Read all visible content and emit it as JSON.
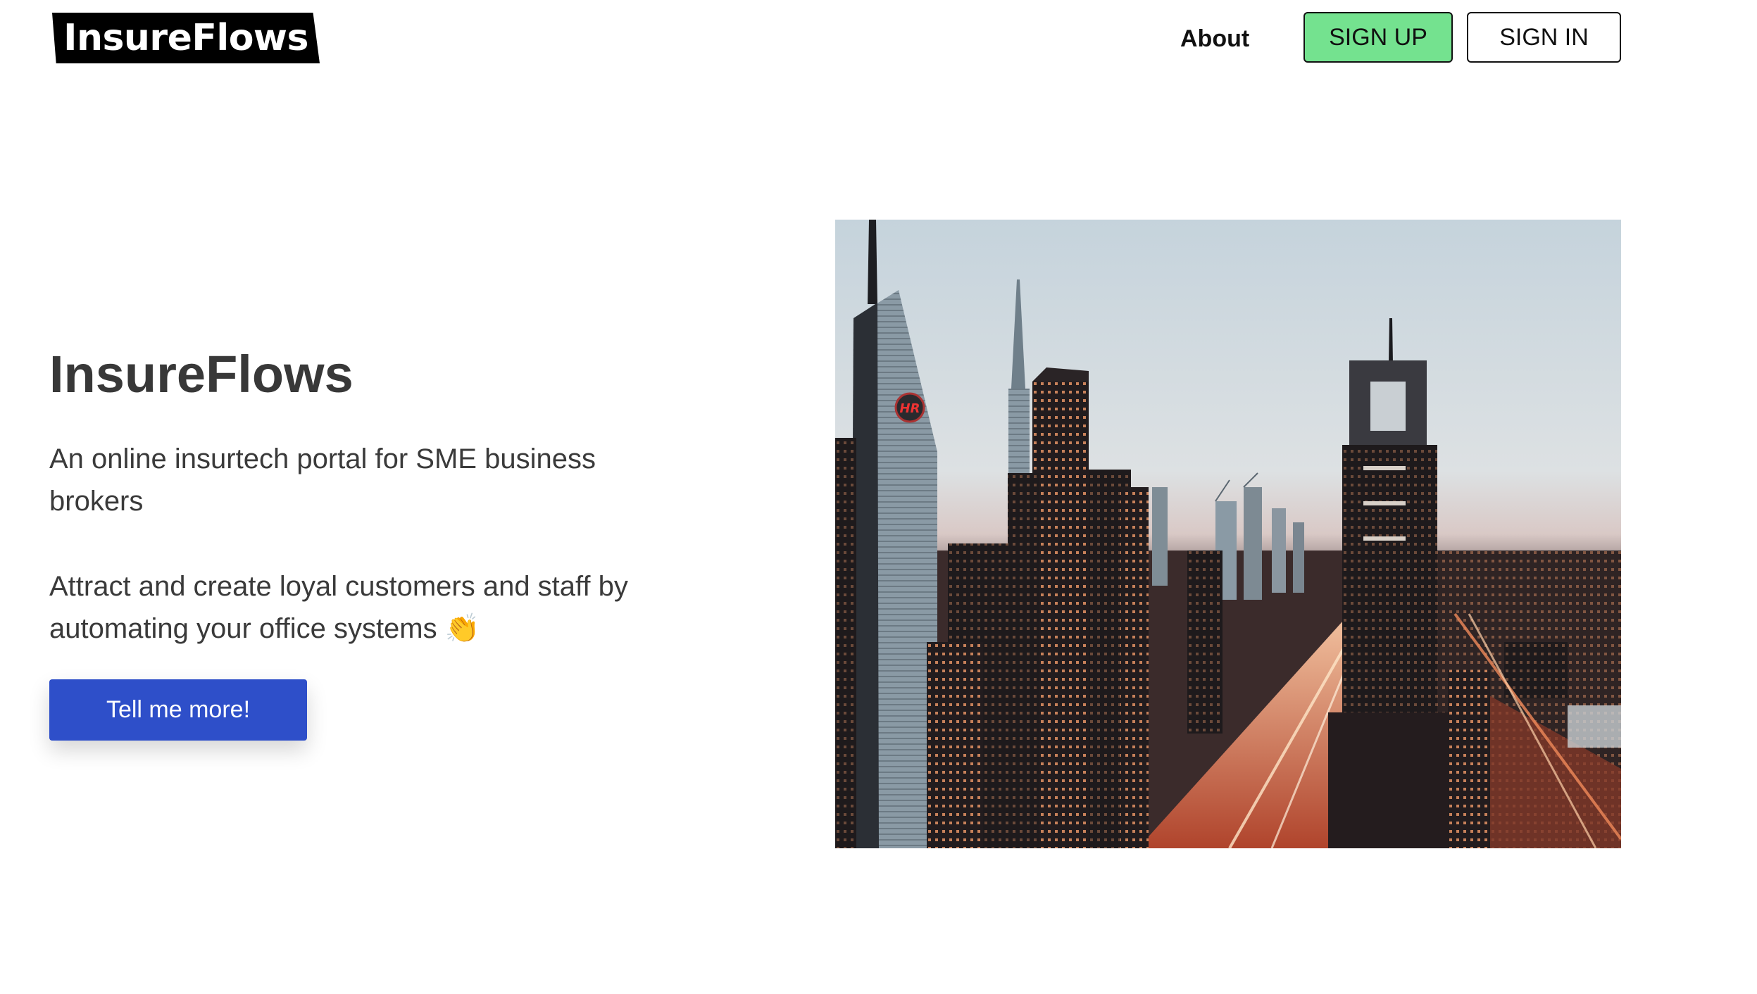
{
  "header": {
    "logo_text": "InsureFlows",
    "nav_about": "About",
    "signup_label": "SIGN UP",
    "signin_label": "SIGN IN"
  },
  "hero": {
    "title": "InsureFlows",
    "subtitle": "An online insurtech portal for SME business brokers",
    "description": "Attract and create loyal customers and staff by automating your office systems 👏",
    "cta_label": "Tell me more!",
    "image_sign_text": "HR"
  },
  "colors": {
    "signup_bg": "#74e28f",
    "cta_bg": "#2e4fc9",
    "text": "#3a3a3a"
  }
}
